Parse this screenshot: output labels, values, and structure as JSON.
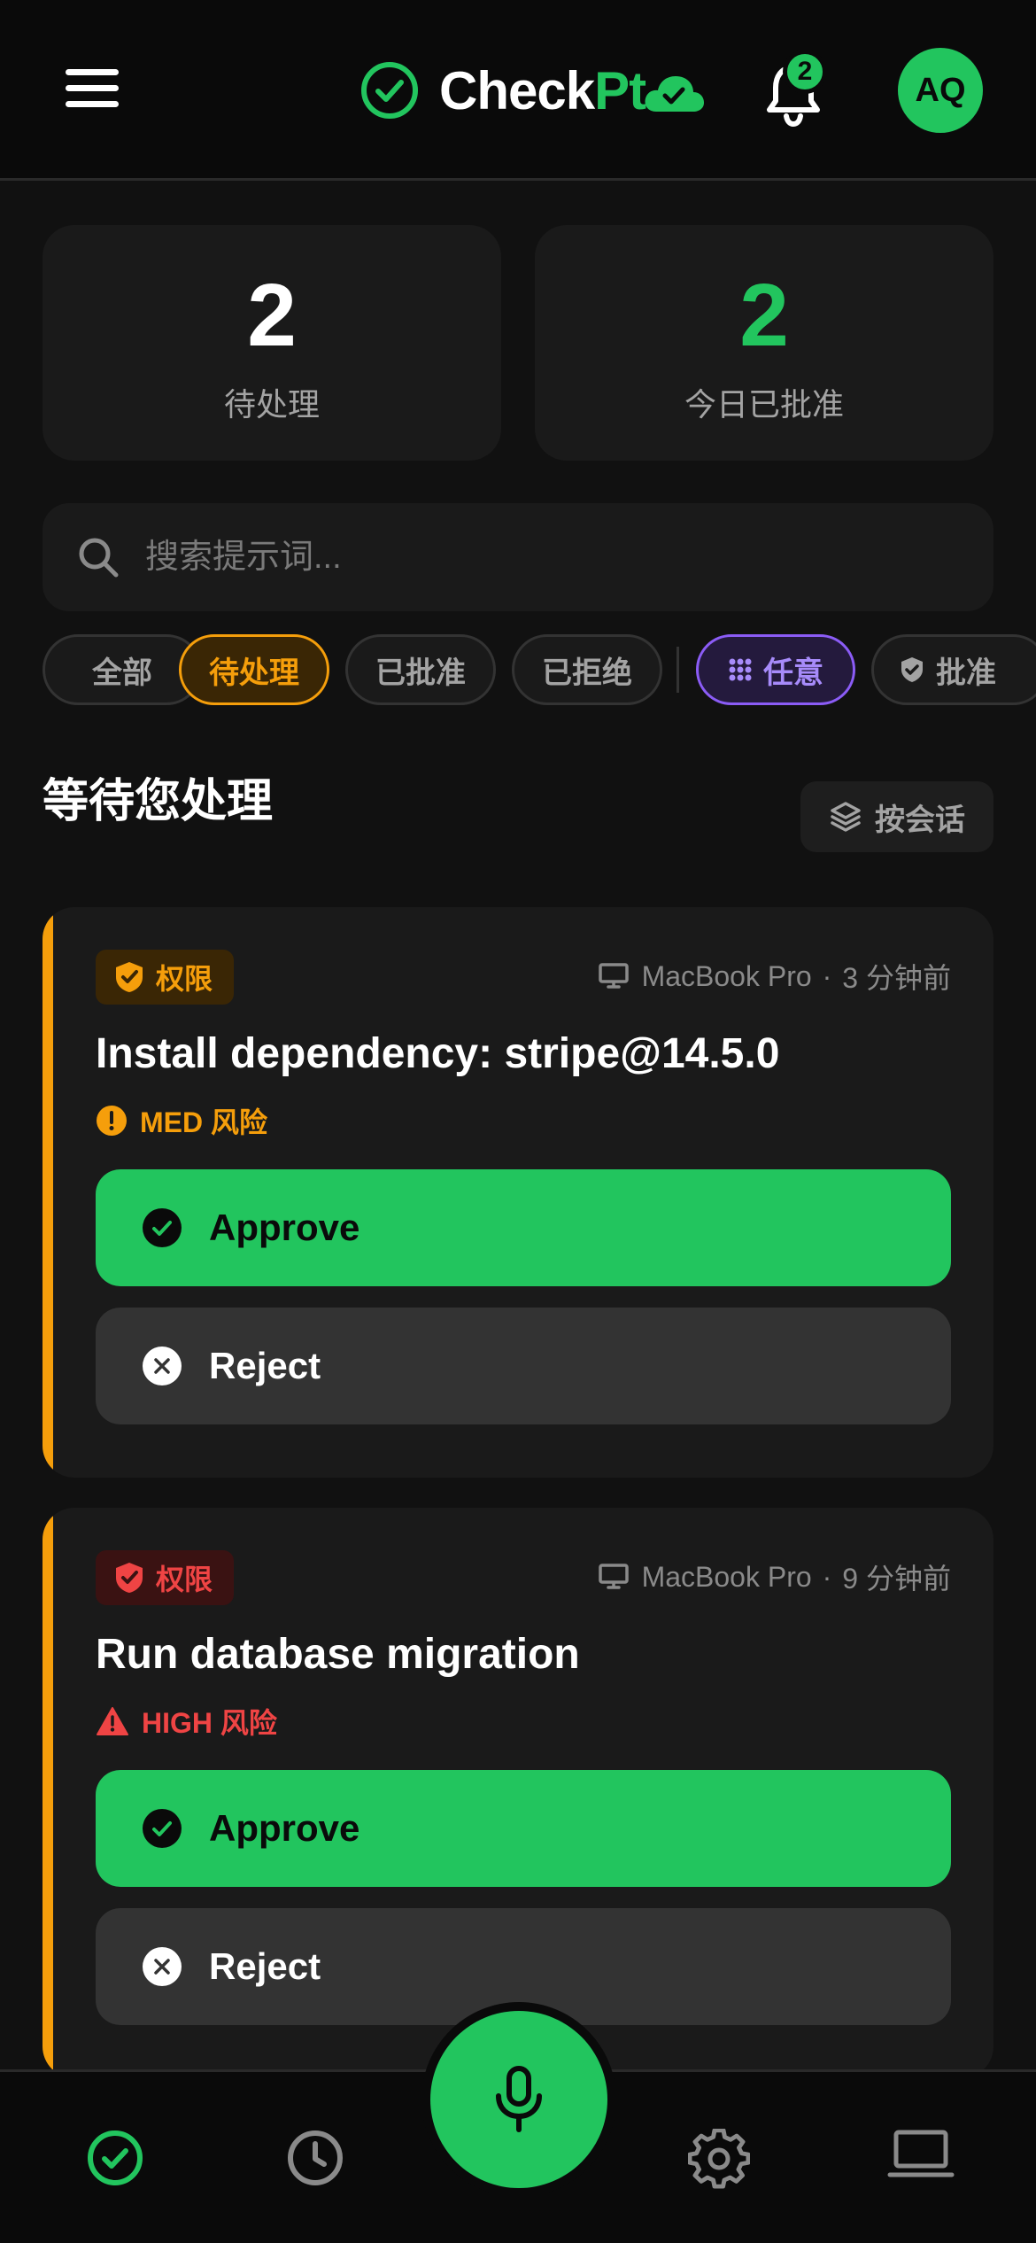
{
  "header": {
    "app_name_a": "Check",
    "app_name_b": "Pt",
    "notification_count": "2",
    "avatar_initials": "AQ"
  },
  "stats": [
    {
      "value": "2",
      "label": "待处理",
      "color": "#ffffff"
    },
    {
      "value": "2",
      "label": "今日已批准",
      "color": "#22c55e"
    }
  ],
  "search": {
    "placeholder": "搜索提示词..."
  },
  "filters": {
    "status": [
      "全部",
      "待处理",
      "已批准",
      "已拒绝"
    ],
    "selected_status": "待处理",
    "types": [
      "任意",
      "批准"
    ],
    "selected_type": "任意"
  },
  "section": {
    "title": "等待您处理",
    "group_label": "按会话"
  },
  "requests": [
    {
      "tag": "权限",
      "device": "MacBook Pro",
      "separator": "·",
      "time": "3 分钟前",
      "title": "Install dependency: stripe@14.5.0",
      "risk": "MED 风险",
      "approve": "Approve",
      "reject": "Reject"
    },
    {
      "tag": "权限",
      "device": "MacBook Pro",
      "separator": "·",
      "time": "9 分钟前",
      "title": "Run database migration",
      "risk": "HIGH 风险",
      "approve": "Approve",
      "reject": "Reject"
    }
  ],
  "colors": {
    "accent": "#22c55e",
    "warning": "#f59e0b",
    "danger": "#ef4444",
    "purple": "#8b5cf6",
    "background": "#111111"
  },
  "icons": [
    "menu-icon",
    "check-circle-icon",
    "cloud-check-icon",
    "bell-icon",
    "search-icon",
    "grid-icon",
    "shield-icon",
    "layers-icon",
    "laptop-icon",
    "alert-circle-icon",
    "warning-triangle-icon",
    "x-circle-icon",
    "mic-icon",
    "clock-icon",
    "gear-icon"
  ]
}
